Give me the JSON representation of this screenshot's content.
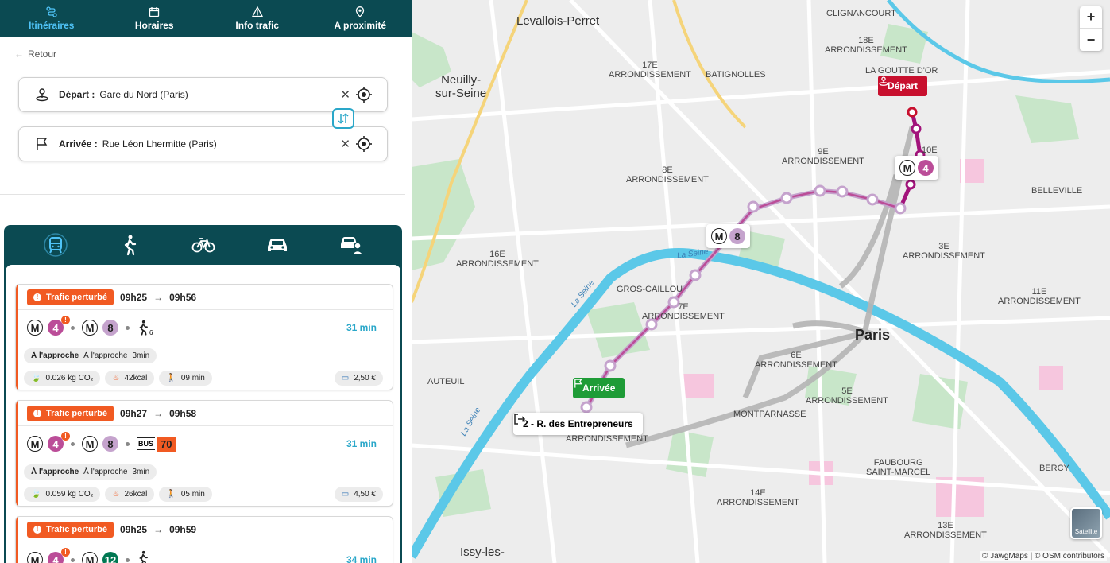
{
  "nav": {
    "items": [
      {
        "label": "Itinéraires",
        "active": true
      },
      {
        "label": "Horaires"
      },
      {
        "label": "Info trafic"
      },
      {
        "label": "A proximité"
      }
    ]
  },
  "back_label": "Retour",
  "depart": {
    "label": "Départ :",
    "value": "Gare du Nord (Paris)"
  },
  "arrivee": {
    "label": "Arrivée :",
    "value": "Rue Léon Lhermitte (Paris)"
  },
  "modes": [
    "train-icon",
    "walk-icon",
    "bike-icon",
    "car-icon",
    "carpool-icon"
  ],
  "results": [
    {
      "status": "Trafic perturbé",
      "depart": "09h25",
      "arrival": "09h56",
      "duration": "31 min",
      "walk_sub": "6",
      "approach1": "À l'approche",
      "approach2": "À l'approche",
      "approach3": "3min",
      "co2": "0.026 kg CO₂",
      "kcal": "42kcal",
      "walk": "09 min",
      "price": "2,50 €"
    },
    {
      "status": "Trafic perturbé",
      "depart": "09h27",
      "arrival": "09h58",
      "duration": "31 min",
      "bus_label": "BUS",
      "bus_num": "70",
      "approach1": "À l'approche",
      "approach2": "À l'approche",
      "approach3": "3min",
      "co2": "0.059 kg CO₂",
      "kcal": "26kcal",
      "walk": "05 min",
      "price": "4,50 €"
    },
    {
      "status": "Trafic perturbé",
      "depart": "09h25",
      "arrival": "09h59",
      "duration": "34 min"
    }
  ],
  "lines": {
    "metro": "M",
    "l4": "4",
    "l8": "8",
    "l12": "12"
  },
  "map": {
    "labels": {
      "levallois": "Levallois-Perret",
      "neuilly": "Neuilly-\nsur-Seine",
      "clignancourt": "CLIGNANCOURT",
      "a18": "18E\nARRONDISSEMENT",
      "goutte": "LA GOUTTE D'OR",
      "a17": "17E\nARRONDISSEMENT",
      "batignolles": "BATIGNOLLES",
      "a9": "9E\nARRONDISSEMENT",
      "a10": "10E",
      "a8": "8E\nARRONDISSEMENT",
      "belleville": "BELLEVILLE",
      "a16": "16E\nARRONDISSEMENT",
      "a3": "3E\nARRONDISSEMENT",
      "gros": "GROS-CAILLOU",
      "a7": "7E\nARRONDISSEMENT",
      "a11": "11E\nARRONDISSEMENT",
      "a6": "6E\nARRONDISSEMENT",
      "auteuil": "AUTEUIL",
      "a5": "5E\nARRONDISSEMENT",
      "montparnasse": "MONTPARNASSE",
      "a15": "ARRONDISSEMENT",
      "faubourg": "FAUBOURG\nSAINT-MARCEL",
      "bercy": "BERCY",
      "a14": "14E\nARRONDISSEMENT",
      "a13": "13E\nARRONDISSEMENT",
      "issy": "Issy-les-",
      "seine1": "La Seine",
      "seine2": "La Seine",
      "seine3": "La Seine"
    },
    "paris": "Paris",
    "depart_marker": "Départ",
    "arrivee_marker": "Arrivée",
    "stop_marker": "2 - R. des Entrepreneurs",
    "zoom_in": "+",
    "zoom_out": "−",
    "satellite": "Satellite",
    "attribution": "© JawgMaps | © OSM contributors"
  }
}
